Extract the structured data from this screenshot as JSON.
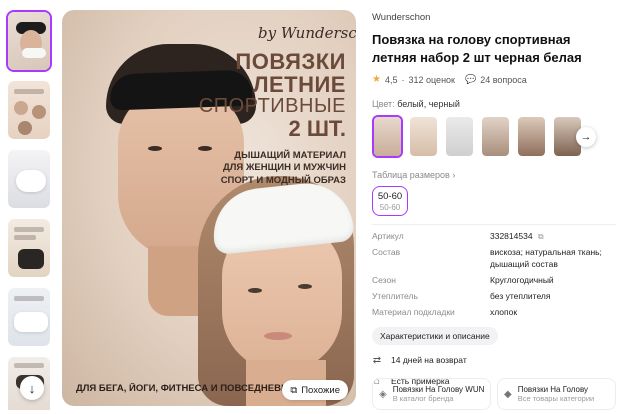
{
  "gallery": {
    "main_image": {
      "brand_script": "by Wunderschon",
      "headline_lines": [
        "ПОВЯЗКИ",
        "ЛЕТНИЕ",
        "СПОРТИВНЫЕ",
        "2 ШТ."
      ],
      "subtitle_lines": [
        "ДЫШАЩИЙ МАТЕРИАЛ",
        "ДЛЯ ЖЕНЩИН И МУЖЧИН",
        "СПОРТ И МОДНЫЙ ОБРАЗ"
      ],
      "bottom_line": "ДЛЯ БЕГА, ЙОГИ, ФИТНЕСА И ПОВСЕДНЕВНОЙ",
      "similar_button": "Похожие"
    },
    "thumbnail_count": 6
  },
  "product": {
    "seller": "Wunderschon",
    "title": "Повязка на голову спортивная летняя набор 2 шт черная белая",
    "rating": "4,5",
    "reviews": "312 оценок",
    "questions": "24 вопроса",
    "color_label": "Цвет:",
    "color_value": "белый, черный",
    "size_table_label": "Таблица размеров",
    "size_chip": {
      "size": "50-60",
      "alt": "50-60"
    }
  },
  "specs": [
    {
      "key": "Артикул",
      "value": "332814534"
    },
    {
      "key": "Состав",
      "value": "вискоза; натуральная ткань; дышащий состав"
    },
    {
      "key": "Сезон",
      "value": "Круглогодичный"
    },
    {
      "key": "Утеплитель",
      "value": "без утеплителя"
    },
    {
      "key": "Материал подкладки",
      "value": "хлопок"
    }
  ],
  "details_button": "Характеристики и описание",
  "features": [
    {
      "icon": "return-arrows-icon",
      "text": "14 дней на возврат"
    },
    {
      "icon": "hanger-icon",
      "text": "Есть примерка"
    }
  ],
  "cards": [
    {
      "title": "Повязки На Голову WUN",
      "subtitle": "В каталог бренда"
    },
    {
      "title": "Повязки На Голову",
      "subtitle": "Все товары категории"
    }
  ],
  "colors": {
    "accent": "#a73afd",
    "star": "#f2a93b"
  }
}
